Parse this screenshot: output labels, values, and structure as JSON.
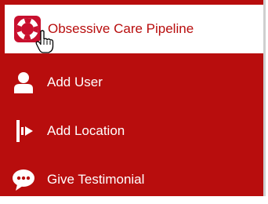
{
  "menu": {
    "items": [
      {
        "label": "Obsessive Care Pipeline",
        "icon": "lifebuoy-icon",
        "active": true
      },
      {
        "label": "Add User",
        "icon": "user-icon",
        "active": false
      },
      {
        "label": "Add Location",
        "icon": "location-flag-icon",
        "active": false
      },
      {
        "label": "Give Testimonial",
        "icon": "chat-bubble-icon",
        "active": false
      }
    ]
  },
  "colors": {
    "menu_background": "#b80d0d",
    "active_background": "#ffffff",
    "active_text": "#b80d0d",
    "text": "#ffffff"
  }
}
